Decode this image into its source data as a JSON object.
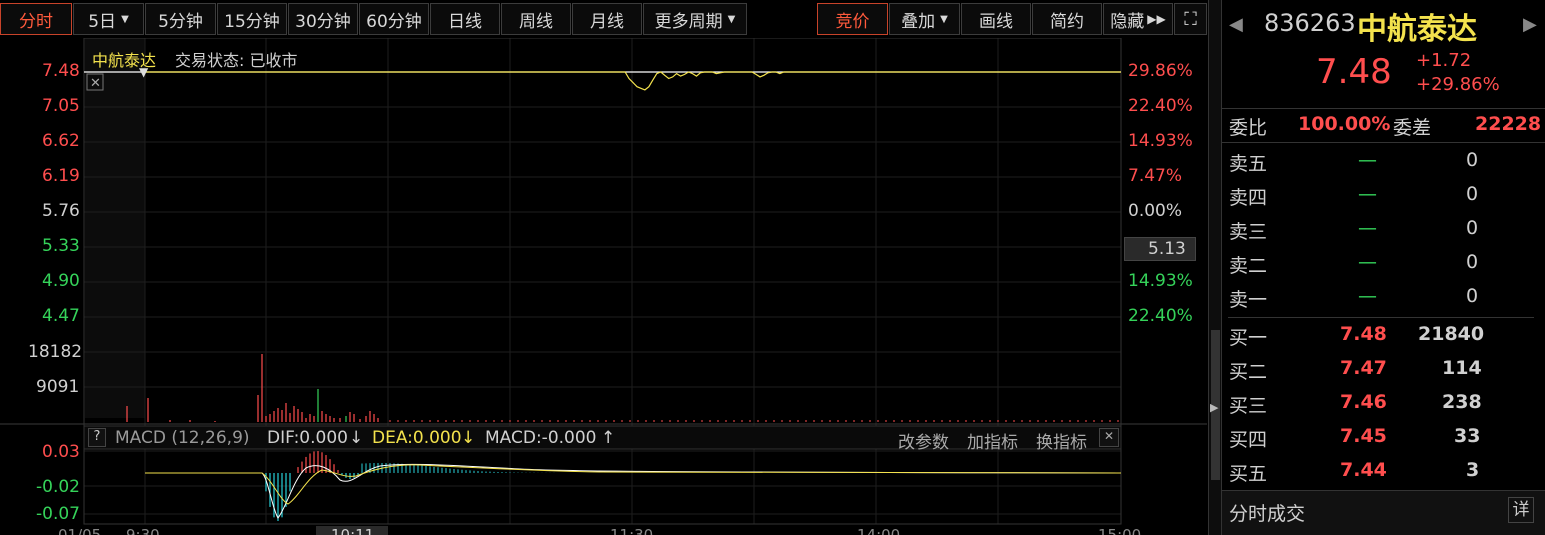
{
  "toolbar": {
    "periods": [
      "分时",
      "5日",
      "5分钟",
      "15分钟",
      "30分钟",
      "60分钟",
      "日线",
      "周线",
      "月线",
      "更多周期"
    ],
    "right_buttons": [
      "竞价",
      "叠加",
      "画线",
      "简约",
      "隐藏"
    ]
  },
  "chart": {
    "stock_name": "中航泰达",
    "status": "交易状态: 已收市",
    "price_axis": [
      "7.48",
      "7.05",
      "6.62",
      "6.19",
      "5.76",
      "5.33",
      "4.90",
      "4.47"
    ],
    "pct_axis": [
      "29.86%",
      "22.40%",
      "14.93%",
      "7.47%",
      "0.00%",
      "14.93%",
      "22.40%"
    ],
    "current_value": "5.13",
    "volume_axis": [
      "18182",
      "9091"
    ],
    "macd": {
      "help": "?",
      "label": "MACD (12,26,9)",
      "dif": "DIF:0.000",
      "dea": "DEA:0.000",
      "macd": "MACD:-0.000",
      "actions": [
        "改参数",
        "加指标",
        "换指标"
      ],
      "axis": [
        "0.03",
        "-0.02",
        "-0.07"
      ]
    },
    "time_axis": [
      "01/05",
      "9:30",
      "10:11",
      "11:30",
      "14:00",
      "15:00"
    ],
    "colors": {
      "up": "#ff4e4e",
      "down": "#35d35a",
      "price_line": "#f3e24d",
      "avg_line": "#ffffff",
      "macd_up": "#ff4e4e",
      "macd_down": "#27d0d8"
    },
    "price_series": [
      7.48,
      7.48,
      7.48,
      7.48,
      7.48,
      7.48,
      7.48,
      7.48,
      7.48,
      7.48,
      7.48,
      7.48,
      7.48,
      7.48,
      7.48,
      7.48,
      7.48,
      7.48,
      7.48,
      7.48,
      7.48,
      7.48,
      7.48,
      7.48,
      7.48,
      7.48,
      7.48,
      7.48,
      7.48,
      7.48,
      7.48,
      7.48,
      7.48,
      7.48,
      7.48,
      7.48,
      7.48,
      7.48,
      7.48,
      7.48,
      7.48,
      7.48,
      7.48,
      7.48,
      7.48,
      7.48,
      7.48,
      7.48,
      7.48,
      7.48,
      7.48,
      7.48,
      7.48,
      7.48,
      7.48,
      7.48,
      7.48,
      7.48,
      7.48,
      7.48,
      7.48,
      7.48,
      7.48,
      7.48,
      7.48,
      7.48,
      7.48,
      7.48,
      7.48,
      7.48,
      7.48,
      7.48,
      7.48,
      7.48,
      7.48,
      7.48,
      7.48,
      7.48,
      7.48,
      7.48,
      7.48,
      7.48,
      7.48,
      7.48,
      7.48,
      7.48,
      7.48,
      7.48,
      7.48,
      7.48,
      7.48,
      7.48,
      7.48,
      7.48,
      7.48,
      7.48,
      7.48,
      7.48,
      7.48,
      7.48,
      7.48,
      7.48,
      7.48,
      7.48,
      7.48,
      7.48,
      7.48,
      7.48,
      7.48,
      7.48,
      7.48,
      7.48,
      7.48,
      7.48,
      7.48,
      7.48,
      7.48,
      7.48,
      7.48,
      7.48,
      7.48,
      7.48,
      7.4,
      7.35,
      7.3,
      7.28,
      7.26,
      7.3,
      7.38,
      7.46,
      7.48,
      7.44,
      7.4,
      7.42,
      7.46,
      7.43,
      7.45,
      7.48,
      7.46,
      7.43,
      7.47,
      7.48,
      7.48,
      7.48,
      7.46,
      7.47,
      7.48,
      7.48,
      7.48,
      7.48,
      7.48,
      7.48,
      7.48,
      7.48,
      7.45,
      7.42,
      7.44,
      7.47,
      7.48,
      7.48,
      7.46,
      7.48,
      7.48,
      7.48,
      7.48,
      7.48,
      7.48,
      7.48,
      7.48,
      7.48,
      7.48,
      7.48,
      7.48,
      7.48,
      7.48,
      7.48,
      7.48,
      7.48,
      7.48,
      7.48,
      7.48,
      7.48,
      7.48,
      7.48,
      7.48,
      7.48,
      7.48,
      7.48,
      7.48,
      7.48,
      7.48,
      7.48,
      7.48,
      7.48,
      7.48,
      7.48,
      7.48,
      7.48,
      7.48,
      7.48,
      7.48,
      7.48,
      7.48,
      7.48,
      7.48,
      7.48,
      7.48,
      7.48,
      7.48,
      7.48,
      7.48,
      7.48,
      7.48,
      7.48,
      7.48,
      7.48,
      7.48,
      7.48,
      7.48,
      7.48,
      7.48,
      7.48,
      7.48,
      7.48,
      7.48,
      7.48,
      7.48,
      7.48,
      7.48,
      7.48,
      7.48,
      7.48,
      7.48,
      7.48,
      7.48,
      7.48,
      7.48,
      7.48,
      7.48,
      7.48,
      7.48,
      7.48,
      7.48,
      7.48,
      7.48,
      7.48,
      7.48
    ]
  },
  "side_panel": {
    "code": "836263",
    "name": "中航泰达",
    "price": "7.48",
    "change": "+1.72",
    "change_pct": "+29.86%",
    "weibi_label": "委比",
    "weibi_value": "100.00%",
    "weicha_label": "委差",
    "weicha_value": "22228",
    "sell": [
      {
        "label": "卖五",
        "price": "—",
        "vol": "0"
      },
      {
        "label": "卖四",
        "price": "—",
        "vol": "0"
      },
      {
        "label": "卖三",
        "price": "—",
        "vol": "0"
      },
      {
        "label": "卖二",
        "price": "—",
        "vol": "0"
      },
      {
        "label": "卖一",
        "price": "—",
        "vol": "0"
      }
    ],
    "buy": [
      {
        "label": "买一",
        "price": "7.48",
        "vol": "21840"
      },
      {
        "label": "买二",
        "price": "7.47",
        "vol": "114"
      },
      {
        "label": "买三",
        "price": "7.46",
        "vol": "238"
      },
      {
        "label": "买四",
        "price": "7.45",
        "vol": "33"
      },
      {
        "label": "买五",
        "price": "7.44",
        "vol": "3"
      }
    ],
    "footer_label": "分时成交",
    "footer_button": "详"
  }
}
